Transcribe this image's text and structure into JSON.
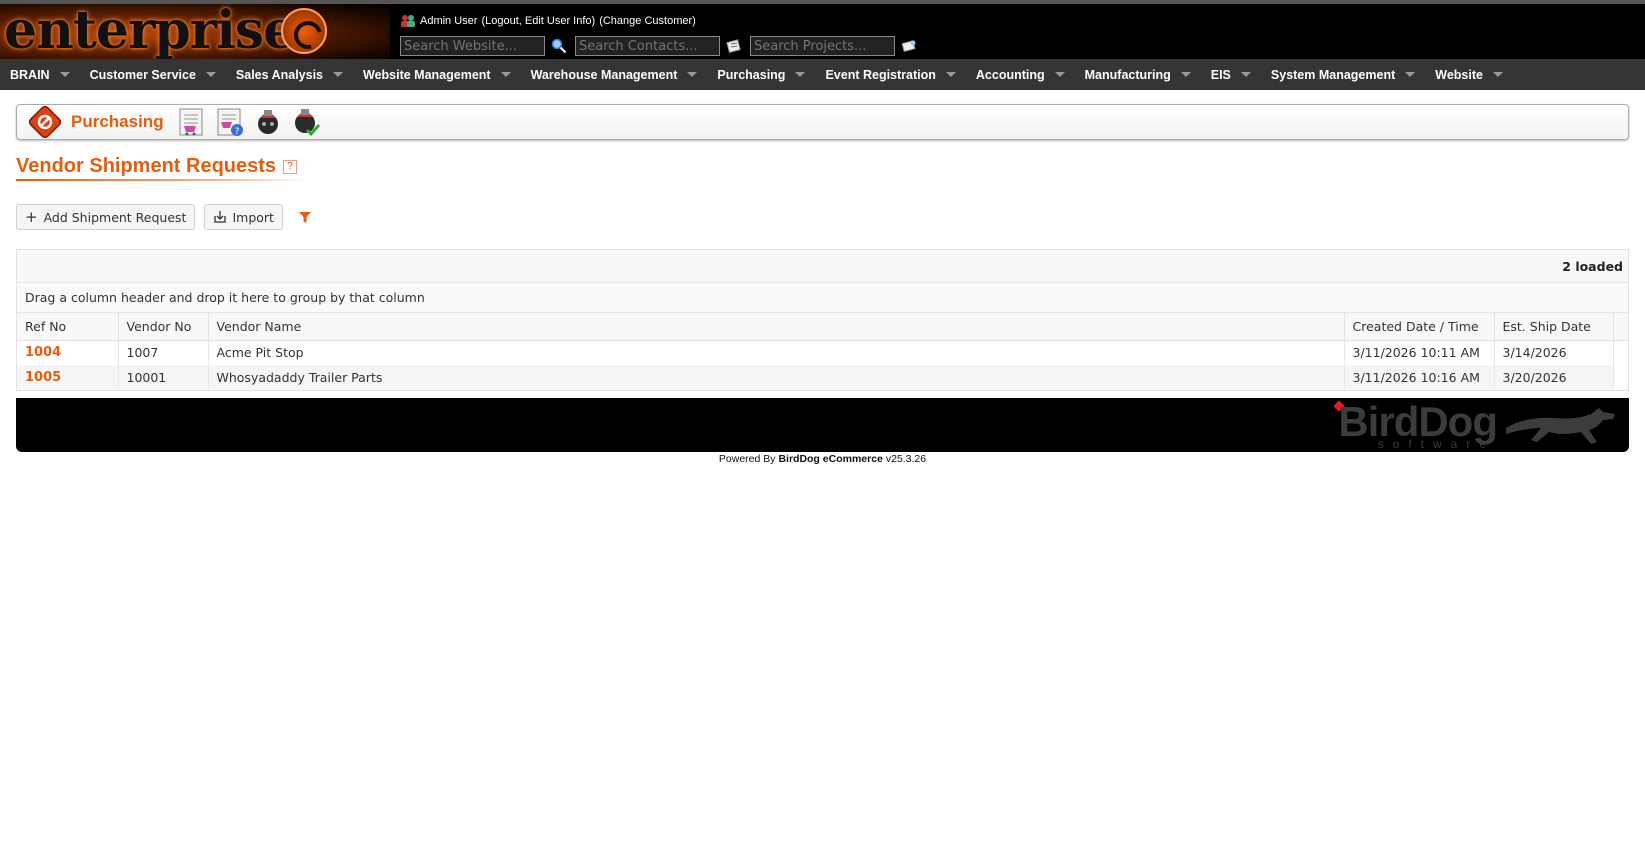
{
  "header": {
    "logo_text": "enterprise",
    "user_line": {
      "name": "Admin User",
      "links_text": "(Logout, Edit User Info)",
      "change_customer": "(Change Customer)"
    },
    "search": {
      "website_placeholder": "Search Website...",
      "contacts_placeholder": "Search Contacts...",
      "projects_placeholder": "Search Projects..."
    }
  },
  "nav": {
    "items": [
      {
        "label": "BRAIN"
      },
      {
        "label": "Customer Service"
      },
      {
        "label": "Sales Analysis"
      },
      {
        "label": "Website Management"
      },
      {
        "label": "Warehouse Management"
      },
      {
        "label": "Purchasing"
      },
      {
        "label": "Event Registration"
      },
      {
        "label": "Accounting"
      },
      {
        "label": "Manufacturing"
      },
      {
        "label": "EIS"
      },
      {
        "label": "System Management"
      },
      {
        "label": "Website"
      }
    ]
  },
  "module": {
    "title": "Purchasing",
    "icons": [
      "purchase-order-icon",
      "purchase-order-help-icon",
      "vendor-shipment-icon",
      "vendor-shipment-approved-icon"
    ]
  },
  "page": {
    "title": "Vendor Shipment Requests",
    "help_glyph": "?"
  },
  "toolbar": {
    "add_label": "Add Shipment Request",
    "import_label": "Import"
  },
  "grid": {
    "loaded_text": "2 loaded",
    "group_hint": "Drag a column header and drop it here to group by that column",
    "columns": [
      "Ref No",
      "Vendor No",
      "Vendor Name",
      "Created Date / Time",
      "Est. Ship Date"
    ],
    "rows": [
      {
        "ref_no": "1004",
        "vendor_no": "1007",
        "vendor_name": "Acme Pit Stop",
        "created": "3/11/2026 10:11 AM",
        "ship_date": "3/14/2026"
      },
      {
        "ref_no": "1005",
        "vendor_no": "10001",
        "vendor_name": "Whosyadaddy Trailer Parts",
        "created": "3/11/2026 10:16 AM",
        "ship_date": "3/20/2026"
      }
    ]
  },
  "footer": {
    "brand": "BirdDog",
    "brand_sub": "software",
    "powered_prefix": "Powered By",
    "powered_product": "BirdDog eCommerce",
    "version": "v25.3.26"
  },
  "colors": {
    "accent": "#e85d0c",
    "nav_bg": "#353535",
    "header_bg": "#000000"
  }
}
